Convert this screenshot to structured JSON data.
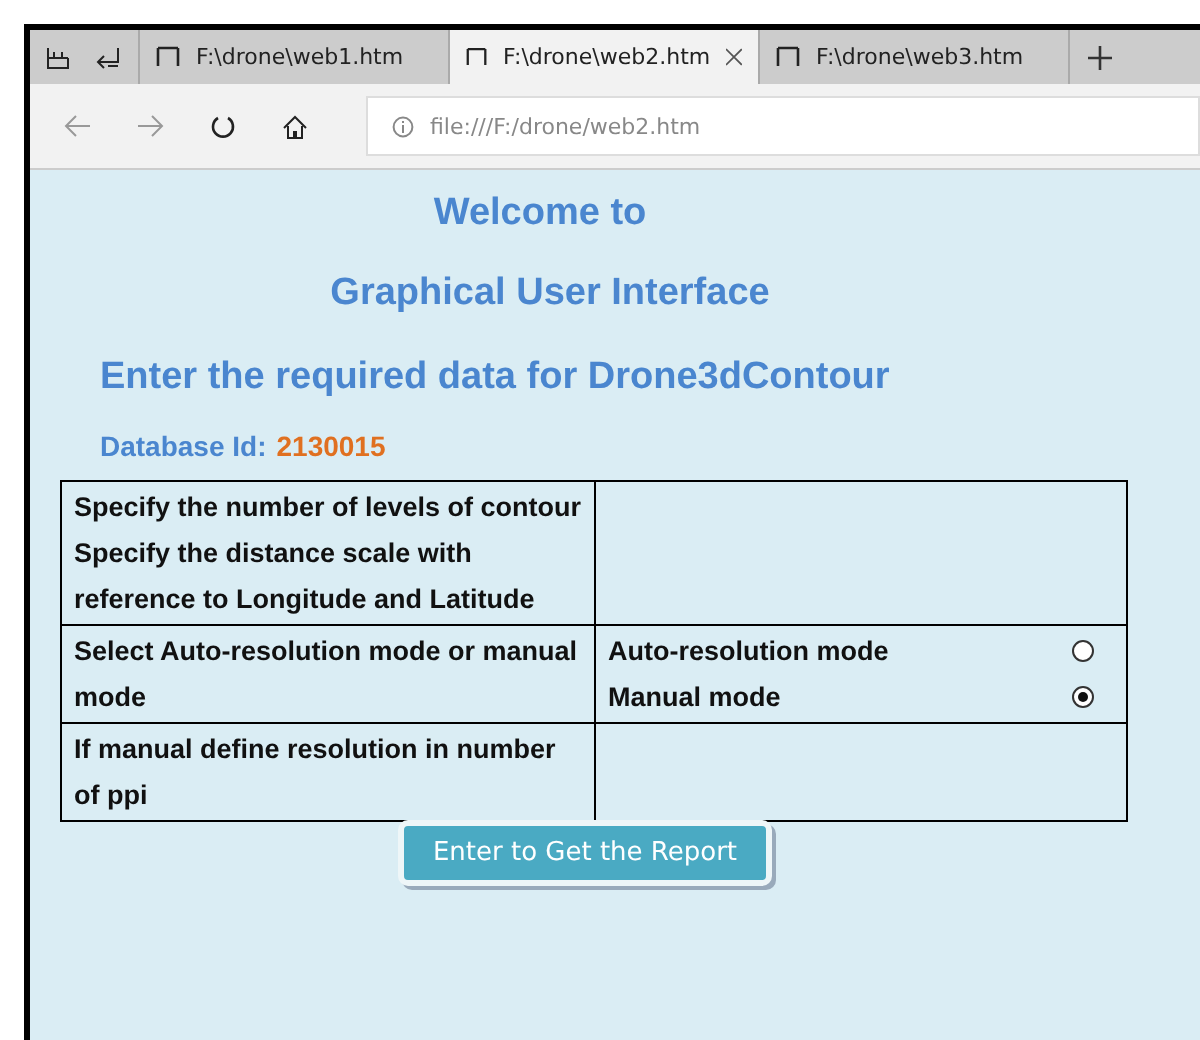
{
  "browser": {
    "tabs": [
      {
        "title": "F:\\drone\\web1.htm",
        "selected": false
      },
      {
        "title": "F:\\drone\\web2.htm",
        "selected": true
      },
      {
        "title": "F:\\drone\\web3.htm",
        "selected": false
      }
    ],
    "address": "file:///F:/drone/web2.htm"
  },
  "page": {
    "welcome": "Welcome to",
    "title": "Graphical User Interface",
    "subtitle": "Enter the required data for Drone3dContour",
    "database_label": "Database Id:",
    "database_id": "2130015",
    "form_rows": [
      {
        "kind": "blank",
        "labels": [
          "Specify the number of levels of contour",
          "Specify the distance scale with reference to Longitude and Latitude"
        ]
      },
      {
        "kind": "radio",
        "labels": [
          "Select Auto-resolution mode or manual mode"
        ],
        "options": [
          {
            "label": "Auto-resolution mode",
            "selected": false
          },
          {
            "label": "Manual mode",
            "selected": true
          }
        ]
      },
      {
        "kind": "blank",
        "labels": [
          "If manual define resolution in number of ppi"
        ]
      }
    ],
    "submit": "Enter to Get the Report"
  }
}
